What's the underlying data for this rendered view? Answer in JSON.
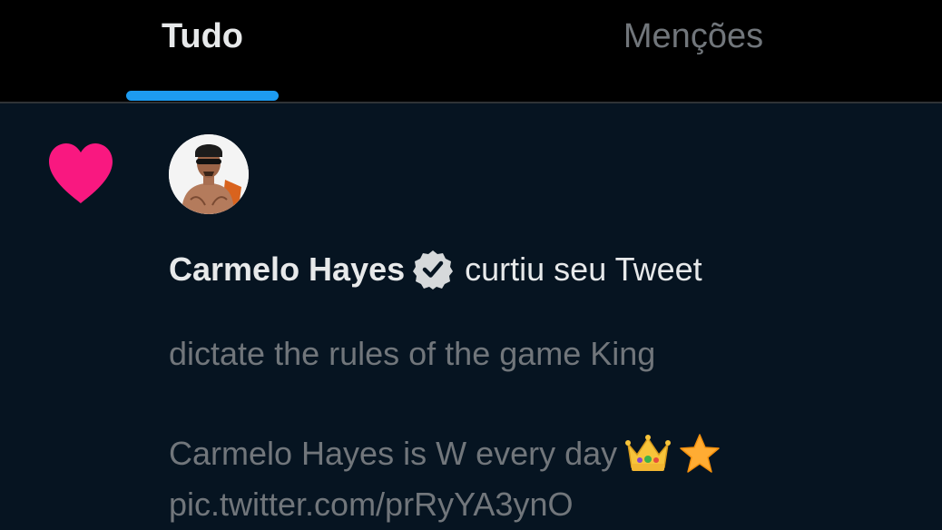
{
  "tabs": [
    {
      "label": "Tudo",
      "active": true
    },
    {
      "label": "Menções",
      "active": false
    }
  ],
  "colors": {
    "accent": "#1d9bf0",
    "like": "#f91880",
    "background": "#061421",
    "primary_text": "#e7e9ea",
    "secondary_text": "#71767b"
  },
  "notification": {
    "type_icon": "heart-icon",
    "user": {
      "name": "Carmelo Hayes",
      "verified": true,
      "avatar_icon": "avatar"
    },
    "action": "curtiu seu Tweet",
    "tweet": {
      "line1": "dictate the rules of the game King",
      "line2": "Carmelo Hayes is W every day",
      "emojis": [
        "crown-emoji",
        "star-emoji"
      ],
      "link": "pic.twitter.com/prRyYA3ynO"
    }
  }
}
